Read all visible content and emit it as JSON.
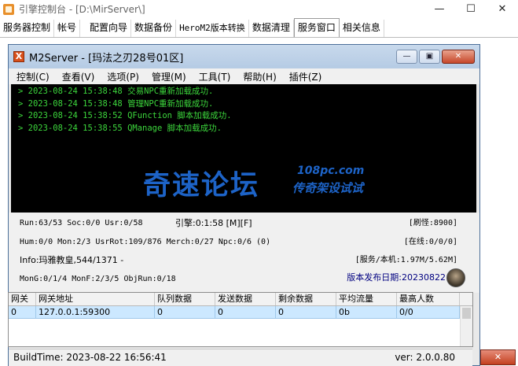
{
  "outer": {
    "title": "引擎控制台 - [D:\\MirServer\\]",
    "minimize": "—",
    "maximize": "☐",
    "close": "✕",
    "tabs": [
      "服务器控制",
      "帐号",
      "配置向导",
      "数据备份",
      "HeroM2版本转换",
      "数据清理",
      "服务窗口",
      "相关信息"
    ],
    "active_tab": 6
  },
  "m2": {
    "title": "M2Server - [玛法之刃28号01区]",
    "icon_glyph": "X",
    "btn_min": "—",
    "btn_max": "▣",
    "btn_close": "✕",
    "menu": [
      "控制(C)",
      "查看(V)",
      "选项(P)",
      "管理(M)",
      "工具(T)",
      "帮助(H)",
      "插件(Z)"
    ],
    "console_lines": [
      "> 2023-08-24 15:38:48 交易NPC重新加载成功.",
      "> 2023-08-24 15:38:48 管理NPC重新加载成功.",
      "> 2023-08-24 15:38:52 QFunction 脚本加载成功.",
      "> 2023-08-24 15:38:55 QManage 脚本加载成功."
    ],
    "watermark": {
      "main": "奇速论坛",
      "site": "108pc.com",
      "slogan": "传奇架设试试"
    },
    "status": {
      "line1": "Run:63/53 Soc:0/0 Usr:0/58",
      "engine": "引擎:0:1:58 [M][F]",
      "refresh": "[刷怪:8900]",
      "line2": "Hum:0/0 Mon:2/3 UsrRot:109/876 Merch:0/27 Npc:0/6 (0)",
      "online": "[在线:0/0/0]",
      "line3": "Info:玛雅教皇,544/1371 -",
      "service": "[服务/本机:1.97M/5.62M]",
      "line4": "MonG:0/1/4 MonF:2/3/5 ObjRun:0/18",
      "release_label": "版本发布日期:",
      "release_date": "20230822"
    },
    "grid": {
      "columns": [
        "网关",
        "网关地址",
        "队列数据",
        "发送数据",
        "剩余数据",
        "平均流量",
        "最高人数"
      ],
      "rows": [
        [
          "0",
          "127.0.0.1:59300",
          "0",
          "0",
          "0",
          "0b",
          "0/0"
        ]
      ]
    },
    "statusbar": {
      "build": "BuildTime:  2023-08-22 16:56:41",
      "version": "ver:  2.0.0.80"
    }
  },
  "bottom_close": "✕"
}
